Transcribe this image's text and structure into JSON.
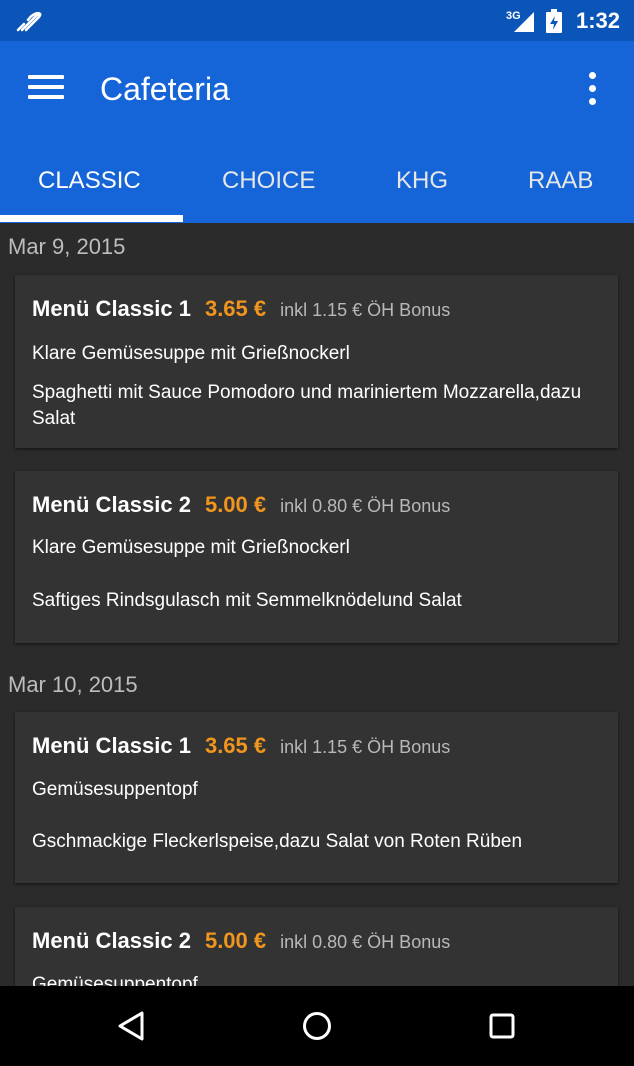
{
  "status_bar": {
    "network_label": "3G",
    "time": "1:32",
    "icons": [
      "notification-icon",
      "cell-signal-icon",
      "battery-charging-icon"
    ]
  },
  "app_bar": {
    "title": "Cafeteria",
    "menu_icon": "hamburger-menu-icon",
    "overflow_icon": "more-vertical-icon",
    "tabs": [
      {
        "label": "CLASSIC",
        "active": true
      },
      {
        "label": "CHOICE",
        "active": false
      },
      {
        "label": "KHG",
        "active": false
      },
      {
        "label": "RAAB",
        "active": false
      }
    ]
  },
  "days": [
    {
      "date": "Mar 9, 2015",
      "menus": [
        {
          "name": "Menü Classic 1",
          "price": "3.65 €",
          "bonus": "inkl 1.15 € ÖH Bonus",
          "soup": "Klare Gemüsesuppe mit Grießnockerl",
          "main": "Spaghetti mit Sauce Pomodoro und mariniertem Mozzarella,dazu Salat"
        },
        {
          "name": "Menü Classic 2",
          "price": "5.00 €",
          "bonus": "inkl 0.80 € ÖH Bonus",
          "soup": "Klare Gemüsesuppe mit Grießnockerl",
          "main": "Saftiges Rindsgulasch mit Semmelknödelund Salat"
        }
      ]
    },
    {
      "date": "Mar 10, 2015",
      "menus": [
        {
          "name": "Menü Classic 1",
          "price": "3.65 €",
          "bonus": "inkl 1.15 € ÖH Bonus",
          "soup": "Gemüsesuppentopf",
          "main": "Gschmackige Fleckerlspeise,dazu Salat von Roten Rüben"
        },
        {
          "name": "Menü Classic 2",
          "price": "5.00 €",
          "bonus": "inkl 0.80 € ÖH Bonus",
          "soup": "Gemüsesuppentopf"
        }
      ]
    }
  ],
  "nav_bar": {
    "icons": [
      "back-icon",
      "home-icon",
      "recents-icon"
    ]
  },
  "colors": {
    "status_bar": "#0b55b8",
    "app_bar": "#1565d8",
    "background": "#2b2b2b",
    "card": "#333333",
    "price_accent": "#f0961e"
  }
}
